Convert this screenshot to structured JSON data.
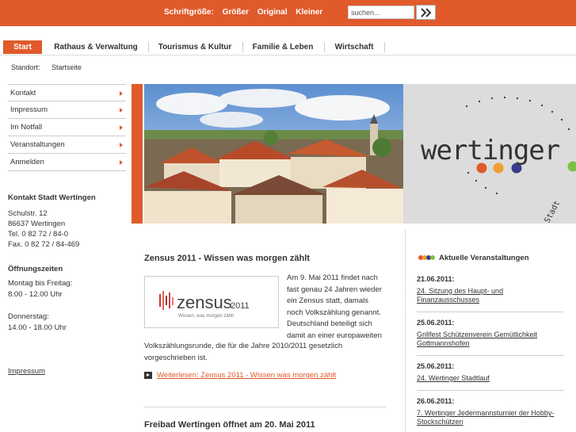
{
  "topbar": {
    "fontsize_label": "Schriftgröße:",
    "bigger": "Größer",
    "original": "Original",
    "smaller": "Kleiner",
    "search_placeholder": "suchen..."
  },
  "nav": {
    "items": [
      "Start",
      "Rathaus & Verwaltung",
      "Tourismus & Kultur",
      "Familie & Leben",
      "Wirtschaft"
    ]
  },
  "breadcrumb": {
    "label": "Standort:",
    "current": "Startseite"
  },
  "sidebar": {
    "items": [
      "Kontakt",
      "Impressum",
      "Im Notfall",
      "Veranstaltungen",
      "Anmelden"
    ],
    "contact_title": "Kontakt Stadt Wertingen",
    "contact_lines": [
      "Schulstr. 12",
      "86637 Wertingen",
      "Tel.  0 82 72 / 84-0",
      "Fax. 0 82 72 / 84-469"
    ],
    "hours_title": "Öffnungszeiten",
    "hours_lines": [
      "Montag bis Freitag:",
      "8.00 - 12.00 Uhr",
      "",
      "Donnerstag:",
      "14.00 - 18.00 Uhr"
    ],
    "impressum": "Impressum"
  },
  "banner": {
    "logo_word": "wertinger",
    "logo_sub": "Stadt"
  },
  "articles": [
    {
      "title": "Zensus 2011 - Wissen was morgen zählt",
      "logo_word": "zensus",
      "logo_year": "2011",
      "logo_tagline": "Wissen, was morgen zählt",
      "body_right": "Am 9. Mai 2011 findet nach fast genau 24 Jahren wieder ein Zensus statt, damals noch Volkszählung genannt. Deutschland beteiligt sich damit an einer europaweiten",
      "body_full": "Volkszählungsrunde, die für die Jahre 2010/2011 gesetzlich vorgeschrieben ist.",
      "readmore": "Weiterlesen: Zensus 2011 - Wissen was morgen zählt"
    },
    {
      "title": "Freibad Wertingen öffnet am 20. Mai 2011"
    }
  ],
  "events": {
    "heading": "Aktuelle Veranstaltungen",
    "dot_colors": [
      "#e05a2b",
      "#f0a030",
      "#3a3a8c",
      "#7ac143"
    ],
    "items": [
      {
        "date": "21.06.2011:",
        "title": "24. Sitzung des Haupt- und Finanzausschusses"
      },
      {
        "date": "25.06.2011:",
        "title": "Grillfest Schützenverein Gemütlichkeit Gottmannshofen"
      },
      {
        "date": "25.06.2011:",
        "title": "24. Wertinger Stadtlauf"
      },
      {
        "date": "26.06.2011:",
        "title": "7. Wertinger Jedermannsturnier der Hobby-Stockschützen"
      }
    ]
  }
}
